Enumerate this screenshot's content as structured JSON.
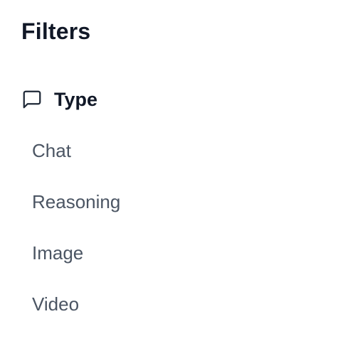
{
  "filters": {
    "title": "Filters",
    "section": {
      "icon": "message-square-icon",
      "label": "Type",
      "options": [
        "Chat",
        "Reasoning",
        "Image",
        "Video"
      ]
    }
  },
  "colors": {
    "title": "#111827",
    "option_text": "#4b5563",
    "icon": "#1f2937"
  }
}
